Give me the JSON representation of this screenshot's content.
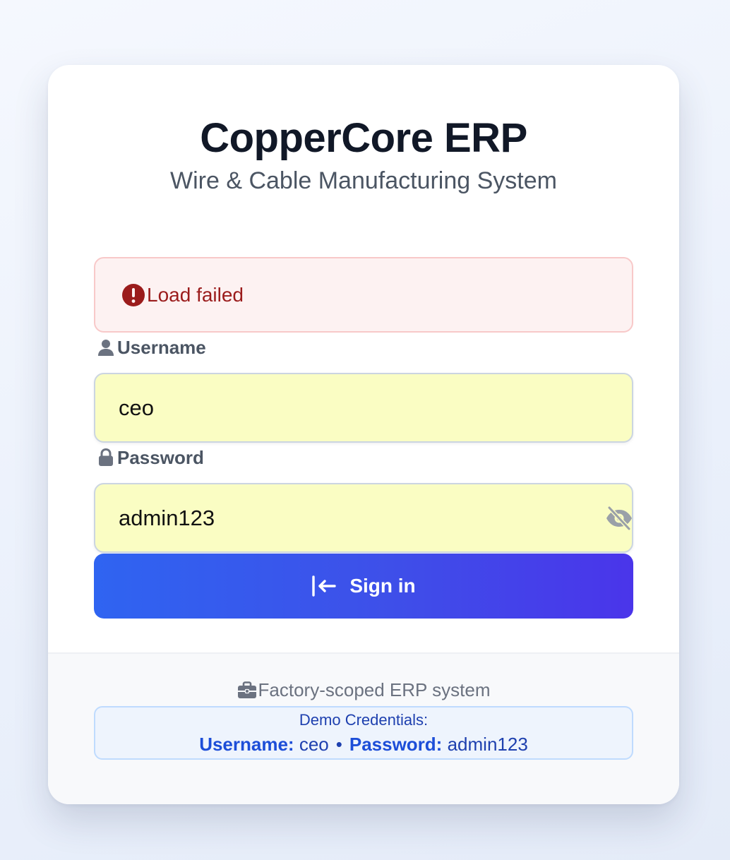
{
  "app": {
    "title": "CopperCore ERP",
    "subtitle": "Wire & Cable Manufacturing System"
  },
  "alert": {
    "icon": "exclamation-circle-icon",
    "message": "Load failed",
    "color": "#9b1c1c"
  },
  "form": {
    "username": {
      "label": "Username",
      "icon": "user-icon",
      "value": "ceo"
    },
    "password": {
      "label": "Password",
      "icon": "lock-icon",
      "value": "admin123",
      "toggle_icon": "eye-slash-icon"
    },
    "submit": {
      "label": "Sign in",
      "icon": "sign-in-arrow-icon"
    }
  },
  "footer": {
    "note": "Factory-scoped ERP system",
    "note_icon": "briefcase-icon",
    "demo": {
      "title": "Demo Credentials:",
      "username_label": "Username:",
      "username_value": "ceo",
      "separator": "•",
      "password_label": "Password:",
      "password_value": "admin123"
    }
  },
  "colors": {
    "accent_start": "#2f64f1",
    "accent_end": "#4a35ea",
    "autofill_bg": "#fafdc3",
    "error_bg": "#fdf2f2"
  }
}
